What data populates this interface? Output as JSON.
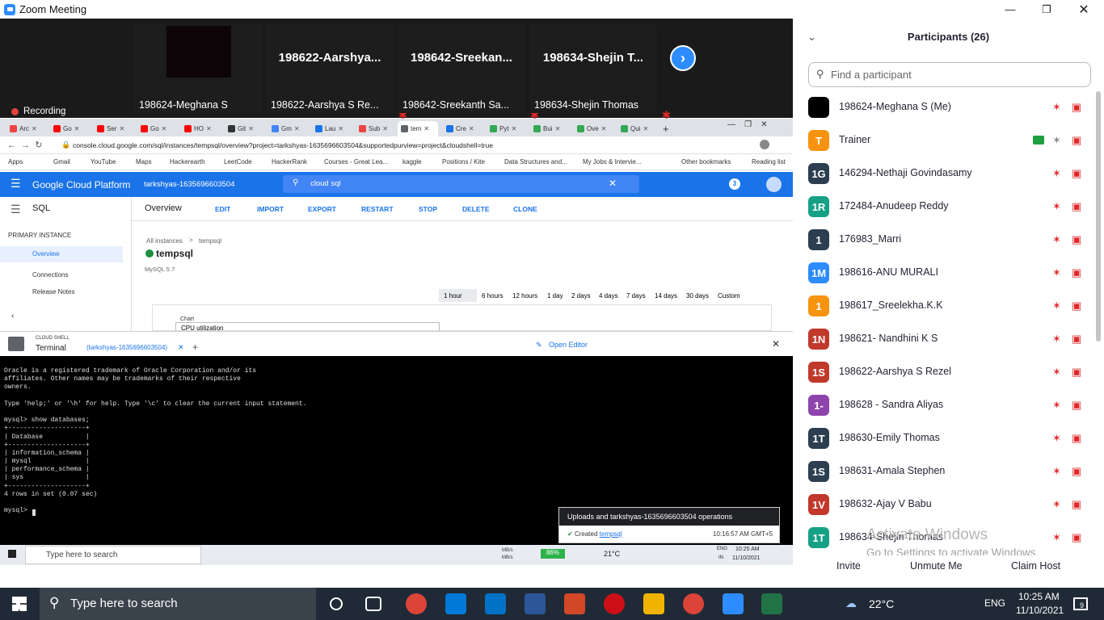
{
  "window": {
    "title": "Zoom Meeting"
  },
  "video": {
    "tiles": [
      {
        "big": "",
        "name": "198624-Meghana S"
      },
      {
        "big": "198622-Aarshya...",
        "name": "198622-Aarshya S Re..."
      },
      {
        "big": "198642-Sreekan...",
        "name": "198642-Sreekanth Sa..."
      },
      {
        "big": "198634-Shejin T...",
        "name": "198634-Shejin Thomas"
      }
    ],
    "recording": "Recording"
  },
  "browser": {
    "tabs": [
      "Arc",
      "Go",
      "Ser",
      "Go",
      "HO",
      "Git",
      "Gm",
      "Lau",
      "Sub",
      "tem",
      "Cre",
      "Pyt",
      "Bui",
      "Ove",
      "Qui"
    ],
    "url": "console.cloud.google.com/sql/instances/tempsql/overview?project=tarkshyas-1635696603504&supportedpurview=project&cloudshell=true",
    "bookmarks": [
      "Apps",
      "Gmail",
      "YouTube",
      "Maps",
      "Hackerearth",
      "LeetCode",
      "HackerRank",
      "Courses - Great Lea...",
      "kaggle",
      "Positions / Kite",
      "Data Structures and...",
      "My Jobs & Intervie...",
      "Other bookmarks",
      "Reading list"
    ]
  },
  "gcp": {
    "title": "Google Cloud Platform",
    "project": "tarkshyas-1635696603504",
    "search": "cloud sql",
    "badge": "3",
    "product": "SQL",
    "nav_section": "PRIMARY INSTANCE",
    "nav_items": [
      "Overview",
      "Connections",
      "Release Notes"
    ],
    "page": "Overview",
    "actions": [
      "EDIT",
      "IMPORT",
      "EXPORT",
      "RESTART",
      "STOP",
      "DELETE",
      "CLONE"
    ],
    "breadcrumb_all": "All instances",
    "breadcrumb_sep": ">",
    "breadcrumb_current": "tempsql",
    "instance": "tempsql",
    "version": "MySQL 5.7",
    "ranges": [
      "1 hour",
      "6 hours",
      "12 hours",
      "1 day",
      "2 days",
      "4 days",
      "7 days",
      "14 days",
      "30 days",
      "Custom"
    ],
    "chart_label": "Chart",
    "chart_select": "CPU utilization"
  },
  "shell": {
    "label": "CLOUD SHELL",
    "tab_terminal": "Terminal",
    "session_tab": "(tarkshyas-1635696603504)",
    "open_editor": "Open Editor",
    "lines": [
      "Oracle is a registered trademark of Oracle Corporation and/or its",
      "affiliates. Other names may be trademarks of their respective",
      "owners.",
      "",
      "Type 'help;' or '\\h' for help. Type '\\c' to clear the current input statement.",
      "",
      "mysql> show databases;",
      "+--------------------+",
      "| Database           |",
      "+--------------------+",
      "| information_schema |",
      "| mysql              |",
      "| performance_schema |",
      "| sys                |",
      "+--------------------+",
      "4 rows in set (0.07 sec)",
      "",
      "mysql> "
    ],
    "toast_title": "Uploads and tarkshyas-1635696603504 operations",
    "toast_created": "Created",
    "toast_link": "tempsql",
    "toast_time": "10:16:57 AM GMT+5"
  },
  "inner_taskbar": {
    "search": "Type here to search",
    "battery": "86%",
    "temp": "21°C",
    "lang": "ENG",
    "region": "IN",
    "time": "10:25 AM",
    "date": "11/10/2021",
    "mb1": "MB/s",
    "mb2": "MB/s"
  },
  "participants": {
    "header": "Participants (26)",
    "find_placeholder": "Find a participant",
    "list": [
      {
        "avatar": "",
        "name": "198624-Meghana S (Me)",
        "color": "#000000"
      },
      {
        "avatar": "T",
        "name": "Trainer",
        "color": "#f7930e"
      },
      {
        "avatar": "1G",
        "name": "146294-Nethaji Govindasamy",
        "color": "#2c3e50"
      },
      {
        "avatar": "1R",
        "name": "172484-Anudeep Reddy",
        "color": "#16a085"
      },
      {
        "avatar": "1",
        "name": "176983_Marri",
        "color": "#2c3e50"
      },
      {
        "avatar": "1M",
        "name": "198616-ANU MURALI",
        "color": "#2d8cff"
      },
      {
        "avatar": "1",
        "name": "198617_Sreelekha.K.K",
        "color": "#f7930e"
      },
      {
        "avatar": "1N",
        "name": "198621- Nandhini K S",
        "color": "#c0392b"
      },
      {
        "avatar": "1S",
        "name": "198622-Aarshya S Rezel",
        "color": "#c0392b"
      },
      {
        "avatar": "1-",
        "name": "198628 - Sandra Aliyas",
        "color": "#8e44ad"
      },
      {
        "avatar": "1T",
        "name": "198630-Emily Thomas",
        "color": "#2c3e50"
      },
      {
        "avatar": "1S",
        "name": "198631-Amala Stephen",
        "color": "#2c3e50"
      },
      {
        "avatar": "1V",
        "name": "198632-Ajay V Babu",
        "color": "#c0392b"
      },
      {
        "avatar": "1T",
        "name": "198634-Shejin Thomas",
        "color": "#16a085"
      }
    ],
    "buttons": [
      "Invite",
      "Unmute Me",
      "Claim Host"
    ],
    "activate_title": "Activate Windows",
    "activate_sub": "Go to Settings to activate Windows."
  },
  "taskbar": {
    "search": "Type here to search",
    "temp": "22°C",
    "lang": "ENG",
    "time": "10:25 AM",
    "date": "11/10/2021",
    "notif": "9"
  }
}
